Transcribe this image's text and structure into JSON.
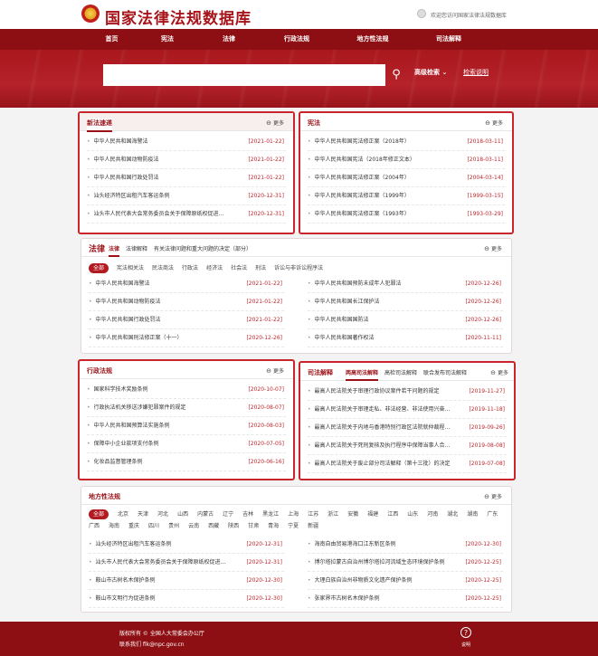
{
  "header": {
    "title": "国家法律法规数据库",
    "welcome": "欢迎您访问国家法律法规数据库"
  },
  "nav": [
    "首页",
    "宪法",
    "法律",
    "行政法规",
    "地方性法规",
    "司法解释"
  ],
  "search": {
    "placeholder": "",
    "advanced": "高级检索",
    "help": "检索说明"
  },
  "latest": {
    "title": "新法速递",
    "more": "更多",
    "items": [
      {
        "t": "中华人民共和国海警法",
        "d": "[2021-01-22]"
      },
      {
        "t": "中华人民共和国动物防疫法",
        "d": "[2021-01-22]"
      },
      {
        "t": "中华人民共和国行政处罚法",
        "d": "[2021-01-22]"
      },
      {
        "t": "汕头经济特区出租汽车客运条例",
        "d": "[2020-12-31]"
      },
      {
        "t": "汕头市人民代表大会常务委员会关于保障原纸权促进…",
        "d": "[2020-12-31]"
      }
    ]
  },
  "constitution": {
    "title": "宪法",
    "more": "更多",
    "items": [
      {
        "t": "中华人民共和国宪法修正案（2018年）",
        "d": "[2018-03-11]"
      },
      {
        "t": "中华人民共和国宪法（2018年修正文本）",
        "d": "[2018-03-11]"
      },
      {
        "t": "中华人民共和国宪法修正案（2004年）",
        "d": "[2004-03-14]"
      },
      {
        "t": "中华人民共和国宪法修正案（1999年）",
        "d": "[1999-03-15]"
      },
      {
        "t": "中华人民共和国宪法修正案（1993年）",
        "d": "[1993-03-29]"
      }
    ]
  },
  "law": {
    "title": "法律",
    "tabs": [
      "法律",
      "法律解释",
      "有关法律问题和重大问题的决定（部分）"
    ],
    "more": "更多",
    "filters": [
      "全部",
      "宪法相关法",
      "民法商法",
      "行政法",
      "经济法",
      "社会法",
      "刑法",
      "诉讼与非诉讼程序法"
    ],
    "left": [
      {
        "t": "中华人民共和国海警法",
        "d": "[2021-01-22]"
      },
      {
        "t": "中华人民共和国动物防疫法",
        "d": "[2021-01-22]"
      },
      {
        "t": "中华人民共和国行政处罚法",
        "d": "[2021-01-22]"
      },
      {
        "t": "中华人民共和国刑法修正案（十一）",
        "d": "[2020-12-26]"
      }
    ],
    "right": [
      {
        "t": "中华人民共和国预防未成年人犯罪法",
        "d": "[2020-12-26]"
      },
      {
        "t": "中华人民共和国长江保护法",
        "d": "[2020-12-26]"
      },
      {
        "t": "中华人民共和国国防法",
        "d": "[2020-12-26]"
      },
      {
        "t": "中华人民共和国著作权法",
        "d": "[2020-11-11]"
      }
    ]
  },
  "admin": {
    "title": "行政法规",
    "more": "更多",
    "items": [
      {
        "t": "国家科学技术奖励条例",
        "d": "[2020-10-07]"
      },
      {
        "t": "行政执法机关移送涉嫌犯罪案件的规定",
        "d": "[2020-08-07]"
      },
      {
        "t": "中华人民共和国预算法实施条例",
        "d": "[2020-08-03]"
      },
      {
        "t": "保障中小企业款项支付条例",
        "d": "[2020-07-05]"
      },
      {
        "t": "化妆品监督管理条例",
        "d": "[2020-06-16]"
      }
    ]
  },
  "judicial": {
    "title": "司法解释",
    "tabs": [
      "两高司法解释",
      "高检司法解释",
      "联合发布司法解释"
    ],
    "more": "更多",
    "items": [
      {
        "t": "最高人民法院关于审理行政协议案件若干问题的规定",
        "d": "[2019-11-27]"
      },
      {
        "t": "最高人民法院关于审理走私、非法经营、非法使用兴奋…",
        "d": "[2019-11-18]"
      },
      {
        "t": "最高人民法院关于内地与香港特别行政区法院就仲裁程…",
        "d": "[2019-09-26]"
      },
      {
        "t": "最高人民法院关于死刑复核及执行程序中保障当事人合…",
        "d": "[2019-08-08]"
      },
      {
        "t": "最高人民法院关于废止部分司法解释（第十三批）的决定",
        "d": "[2019-07-08]"
      }
    ]
  },
  "local": {
    "title": "地方性法规",
    "more": "更多",
    "regions": [
      "全部",
      "北京",
      "天津",
      "河北",
      "山西",
      "内蒙古",
      "辽宁",
      "吉林",
      "黑龙江",
      "上海",
      "江苏",
      "浙江",
      "安徽",
      "福建",
      "江西",
      "山东",
      "河南",
      "湖北",
      "湖南",
      "广东",
      "广西",
      "海南",
      "重庆",
      "四川",
      "贵州",
      "云南",
      "西藏",
      "陕西",
      "甘肃",
      "青海",
      "宁夏",
      "新疆"
    ],
    "left": [
      {
        "t": "汕头经济特区出租汽车客运条例",
        "d": "[2020-12-31]"
      },
      {
        "t": "汕头市人民代表大会常务委员会关于保障原纸权促进…",
        "d": "[2020-12-31]"
      },
      {
        "t": "鞍山市古树名木保护条例",
        "d": "[2020-12-30]"
      },
      {
        "t": "鞍山市文明行为促进条例",
        "d": "[2020-12-30]"
      }
    ],
    "right": [
      {
        "t": "海南自由贸易港海口江东新区条例",
        "d": "[2020-12-30]"
      },
      {
        "t": "博尔塔拉蒙古自治州博尔塔拉河流域生态环境保护条例",
        "d": "[2020-12-25]"
      },
      {
        "t": "大理白族自治州非物质文化遗产保护条例",
        "d": "[2020-12-25]"
      },
      {
        "t": "张家界市古树名木保护条例",
        "d": "[2020-12-25]"
      }
    ]
  },
  "footer": {
    "copyright": "版权所有 © 全国人大常委会办公厅",
    "contact": "联系我们 flk@npc.gov.cn",
    "help": "说明"
  }
}
